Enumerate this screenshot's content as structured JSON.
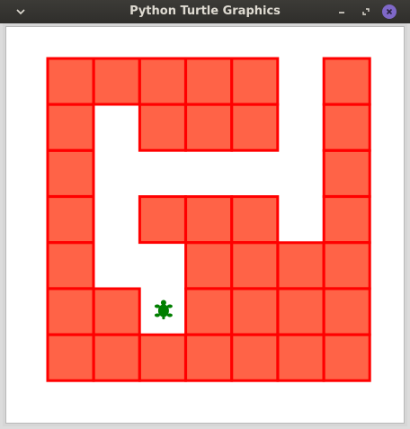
{
  "window": {
    "title": "Python Turtle Graphics",
    "icons": {
      "menu": "chevron-down-icon",
      "minimize": "minimize-icon",
      "restore": "restore-icon",
      "close": "close-icon"
    }
  },
  "colors": {
    "titlebar": "#33322f",
    "title_text": "#dfdbd2",
    "close_button": "#7f68c8",
    "tile_fill": "#ff6347",
    "tile_stroke": "#ff0000",
    "turtle": "#007f00",
    "canvas_bg": "#ffffff"
  },
  "maze": {
    "rows": [
      "11111.1",
      "1.111.1",
      "1.....1",
      "1.111.1",
      "1..1111",
      "11.1111",
      "1111111"
    ],
    "turtle_cell": {
      "row": 5,
      "col": 2
    },
    "turtle_icon": "turtle-icon"
  }
}
